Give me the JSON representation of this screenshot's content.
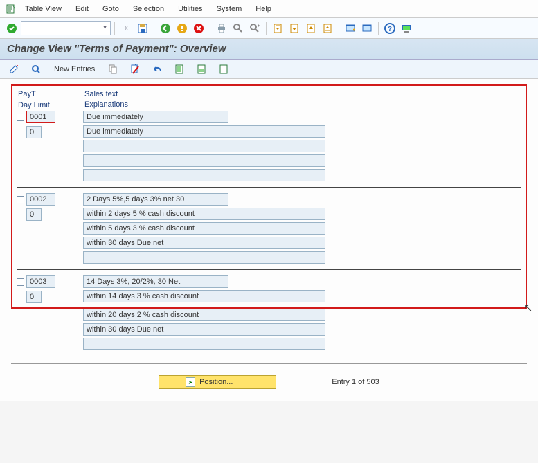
{
  "menu": {
    "items": [
      "Table View",
      "Edit",
      "Goto",
      "Selection",
      "Utilities",
      "System",
      "Help"
    ],
    "underline_idx": [
      0,
      0,
      0,
      0,
      4,
      1,
      0
    ]
  },
  "header": {
    "title": "Change View \"Terms of Payment\": Overview"
  },
  "apptoolbar": {
    "new_entries": "New Entries"
  },
  "columns": {
    "payt": "PayT",
    "day_limit": "Day Limit",
    "sales_text": "Sales text",
    "explanations": "Explanations"
  },
  "entries": [
    {
      "payt": "0001",
      "day_limit": "0",
      "sales_text": "Due immediately",
      "selected": true,
      "lines": [
        "Due immediately",
        "",
        "",
        ""
      ]
    },
    {
      "payt": "0002",
      "day_limit": "0",
      "sales_text": "2 Days 5%,5 days 3% net 30",
      "selected": false,
      "lines": [
        "within 2 days 5 % cash discount",
        "within 5 days 3 % cash discount",
        "within 30 days Due net",
        ""
      ]
    },
    {
      "payt": "0003",
      "day_limit": "0",
      "sales_text": "14 Days 3%, 20/2%, 30 Net",
      "selected": false,
      "lines": [
        "within 14 days 3 % cash discount",
        "within 20 days 2 % cash discount",
        "within 30 days Due net",
        ""
      ]
    }
  ],
  "footer": {
    "position": "Position...",
    "entry_text": "Entry 1 of 503"
  }
}
